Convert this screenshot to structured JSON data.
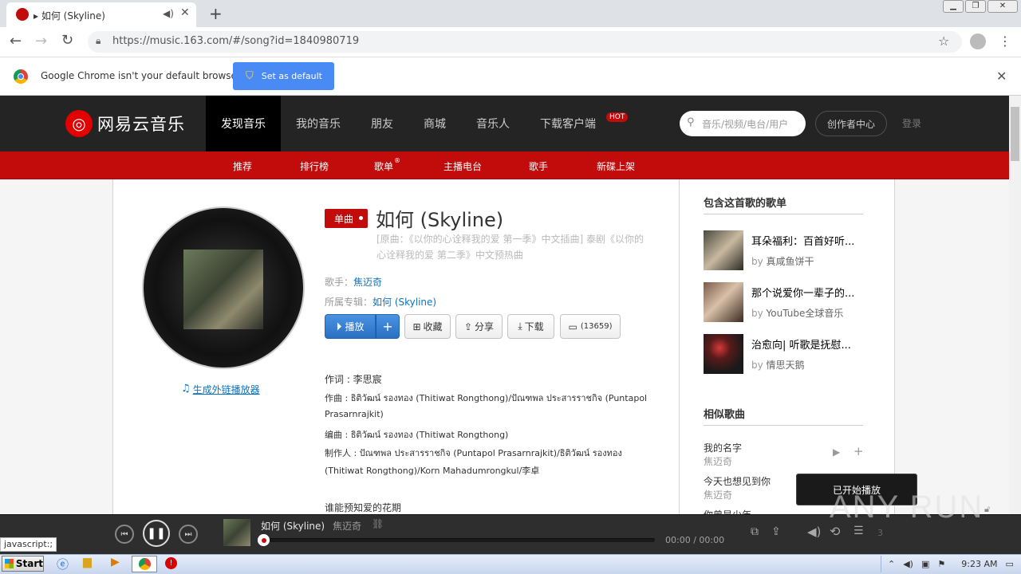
{
  "browser": {
    "tab_title": "▸ 如何 (Skyline)",
    "url": "https://music.163.com/#/song?id=1840980719",
    "infobar_text": "Google Chrome isn't your default browser",
    "set_default_label": "Set as default"
  },
  "site": {
    "logo_text": "网易云音乐",
    "nav": [
      "发现音乐",
      "我的音乐",
      "朋友",
      "商城",
      "音乐人",
      "下载客户端"
    ],
    "hot_badge": "HOT",
    "search_placeholder": "音乐/视频/电台/用户",
    "creator_center": "创作者中心",
    "login": "登录",
    "subnav": [
      "推荐",
      "排行榜",
      "歌单",
      "主播电台",
      "歌手",
      "新碟上架"
    ],
    "subnav_reg_mark": "®"
  },
  "song": {
    "tag": "单曲",
    "title": "如何 (Skyline)",
    "subtitle": "[原曲：《以你的心诠释我的爱 第一季》中文插曲] 泰剧《以你的心诠释我的爱 第二季》中文预热曲",
    "artist_label": "歌手：",
    "artist": "焦迈奇",
    "album_label": "所属专辑：",
    "album": "如何 (Skyline)",
    "generate_player": "生成外链播放器",
    "buttons": {
      "play": "播放",
      "add": "+",
      "collect": "收藏",
      "share": "分享",
      "download": "下载",
      "comments": "(13659)"
    },
    "lyrics": [
      "作词 : 李思宸",
      "作曲 : ธิติวัฒน์ รองทอง (Thitiwat Rongthong)/ปัณฑพล ประสารราชกิจ (Puntapol",
      "Prasarnrajkit)",
      "编曲 : ธิติวัฒน์ รองทอง (Thitiwat Rongthong)",
      "制作人 : ปัณฑพล ประสารราชกิจ (Puntapol Prasarnrajkit)/ธิติวัฒน์ รองทอง",
      "(Thitiwat Rongthong)/Korn Mahadumrongkul/李卓",
      "",
      "谁能预知爱的花期"
    ]
  },
  "sidebar": {
    "playlists_title": "包含这首歌的歌单",
    "playlists": [
      {
        "name": "耳朵福利：百首好听...",
        "by": "by",
        "author": "真咸鱼饼干"
      },
      {
        "name": "那个说爱你一辈子的...",
        "by": "by",
        "author": "YouTube全球音乐"
      },
      {
        "name": "治愈向| 听歌是抚慰...",
        "by": "by",
        "author": "情思天鹅"
      }
    ],
    "similar_title": "相似歌曲",
    "similar": [
      {
        "name": "我的名字",
        "artist": "焦迈奇"
      },
      {
        "name": "今天也想见到你",
        "artist": "焦迈奇"
      },
      {
        "name": "你曾是少年",
        "artist": ""
      }
    ]
  },
  "toast": "已开始播放",
  "watermark": "ANY RUN",
  "player": {
    "song": "如何 (Skyline)",
    "artist": "焦迈奇",
    "time": "00:00 / 00:00",
    "list_count": "3",
    "progress": 0
  },
  "status_bar": "javascript:;",
  "taskbar": {
    "start": "Start",
    "clock": "9:23 AM"
  },
  "colors": {
    "brand_red": "#c20c0c",
    "nav_bg": "#242424",
    "link": "#0c73c2",
    "play_blue": "#2f7ad1"
  }
}
